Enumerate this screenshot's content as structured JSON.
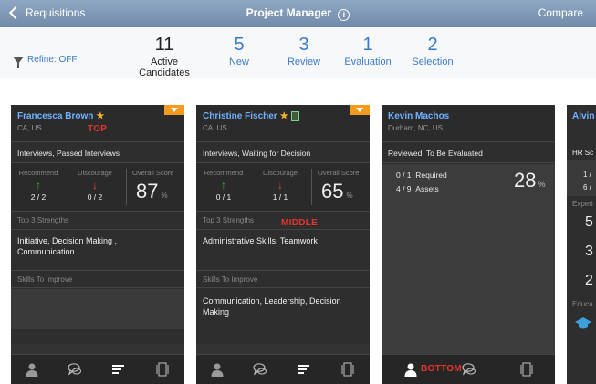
{
  "nav": {
    "back_label": "Requisitions",
    "title": "Project Manager",
    "info_glyph": "i",
    "compare_label": "Compare"
  },
  "stats_bar": {
    "refine_label": "Refine: OFF",
    "items": [
      {
        "count": "11",
        "label": "Active Candidates"
      },
      {
        "count": "5",
        "label": "New"
      },
      {
        "count": "3",
        "label": "Review"
      },
      {
        "count": "1",
        "label": "Evaluation"
      },
      {
        "count": "2",
        "label": "Selection"
      }
    ]
  },
  "colors": {
    "accent_blue": "#3a7ac8",
    "card_bg": "#2e2e2e",
    "name_blue": "#6fb2ff",
    "star": "#f6b12a",
    "menu_tab": "#f49b1f",
    "overlay_red": "#e3352d"
  },
  "cards": [
    {
      "name": "Francesca Brown",
      "location": "CA, US",
      "status": "Interviews, Passed Interviews",
      "recommend_label": "Recommend",
      "discourage_label": "Discourage",
      "overall_label": "Overall Score",
      "recommend_ratio": "2 / 2",
      "discourage_ratio": "0 / 2",
      "overall_score": "87",
      "percent_sign": "%",
      "strengths_label": "Top 3 Strengths",
      "strengths_text": "Initiative, Decision Making , Communication",
      "improve_label": "Skills To Improve",
      "improve_text": "",
      "overlay": "TOP"
    },
    {
      "name": "Christine Fischer",
      "location": "CA, US",
      "status": "Interviews, Waiting for Decision",
      "recommend_label": "Recommend",
      "discourage_label": "Discourage",
      "overall_label": "Overall Score",
      "recommend_ratio": "0 / 1",
      "discourage_ratio": "1 / 1",
      "overall_score": "65",
      "percent_sign": "%",
      "strengths_label": "Top 3 Strengths",
      "strengths_text": "Administrative Skills, Teamwork",
      "improve_label": "Skills To Improve",
      "improve_text": "Communication, Leadership, Decision Making",
      "overlay": "MIDDLE"
    },
    {
      "name": "Kevin Machos",
      "location": "Durham, NC, US",
      "status": "Reviewed, To Be Evaluated",
      "required_ratio": "0 / 1",
      "required_label": "Required",
      "assets_ratio": "4 / 9",
      "assets_label": "Assets",
      "percent": "28",
      "percent_sign": "%",
      "overlay": "BOTTOM"
    },
    {
      "name": "Alvin",
      "location": "",
      "partial_rows": [
        "HR Sc",
        "1 /",
        "6 /",
        "Experi",
        "5",
        "3",
        "2",
        "Educa"
      ]
    }
  ],
  "icons": [
    "chevron-left-icon",
    "info-icon",
    "funnel-icon",
    "star-icon",
    "document-icon",
    "dropdown-caret-icon",
    "thumbs-up-arrow-icon",
    "thumbs-down-arrow-icon",
    "person-icon",
    "chat-bubbles-icon",
    "list-bars-icon",
    "stack-cards-icon",
    "graduation-cap-icon"
  ]
}
